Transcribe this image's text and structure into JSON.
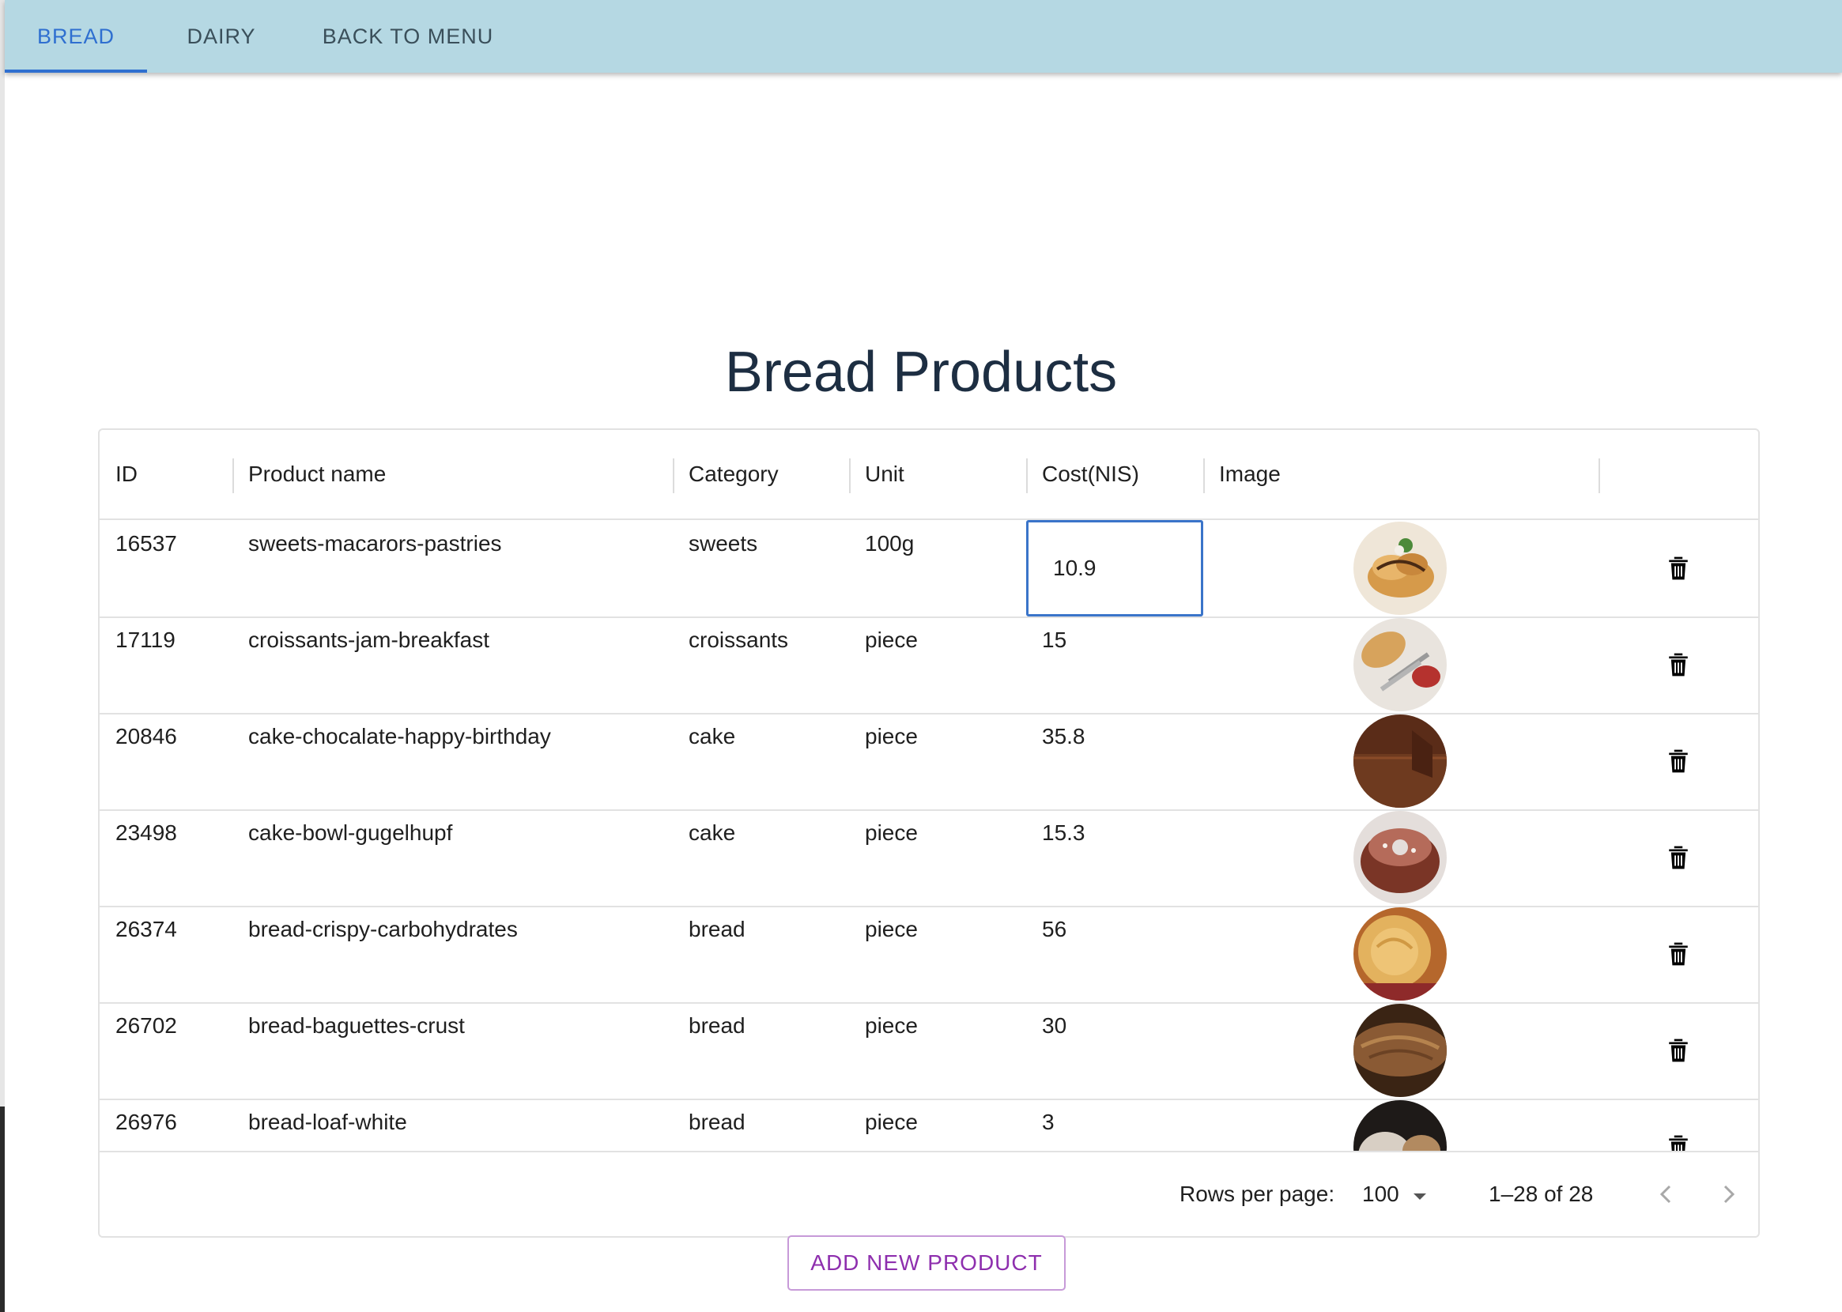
{
  "nav": {
    "tabs": [
      {
        "label": "BREAD",
        "active": true
      },
      {
        "label": "DAIRY",
        "active": false
      },
      {
        "label": "BACK TO MENU",
        "active": false
      }
    ]
  },
  "page": {
    "title": "Bread Products"
  },
  "table": {
    "columns": [
      "ID",
      "Product name",
      "Category",
      "Unit",
      "Cost(NIS)",
      "Image"
    ],
    "rows": [
      {
        "id": "16537",
        "name": "sweets-macarors-pastries",
        "category": "sweets",
        "unit": "100g",
        "cost": "10.9",
        "editing": true,
        "image": "pastries-photo"
      },
      {
        "id": "17119",
        "name": "croissants-jam-breakfast",
        "category": "croissants",
        "unit": "piece",
        "cost": "15",
        "image": "croissants-photo"
      },
      {
        "id": "20846",
        "name": "cake-chocalate-happy-birthday",
        "category": "cake",
        "unit": "piece",
        "cost": "35.8",
        "image": "chocolate-cake-photo"
      },
      {
        "id": "23498",
        "name": "cake-bowl-gugelhupf",
        "category": "cake",
        "unit": "piece",
        "cost": "15.3",
        "image": "gugelhupf-photo"
      },
      {
        "id": "26374",
        "name": "bread-crispy-carbohydrates",
        "category": "bread",
        "unit": "piece",
        "cost": "56",
        "image": "crispy-bread-photo"
      },
      {
        "id": "26702",
        "name": "bread-baguettes-crust",
        "category": "bread",
        "unit": "piece",
        "cost": "30",
        "image": "baguette-photo"
      },
      {
        "id": "26976",
        "name": "bread-loaf-white",
        "category": "bread",
        "unit": "piece",
        "cost": "3",
        "image": "white-loaf-photo"
      }
    ],
    "actions_icon": "trash-icon"
  },
  "pagination": {
    "rows_per_page_label": "Rows per page:",
    "rows_per_page_value": "100",
    "range_text": "1–28 of 28"
  },
  "actions": {
    "add_label": "ADD NEW PRODUCT"
  },
  "colors": {
    "appbar": "#b5d8e3",
    "tab_active": "#2f6fd0",
    "edit_border": "#3a74c9",
    "add_button": "#8e2fae"
  }
}
